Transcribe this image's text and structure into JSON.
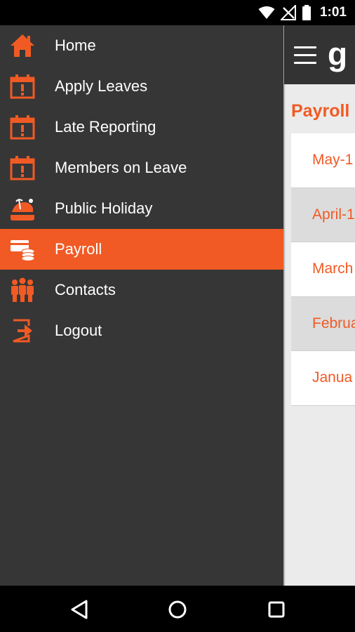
{
  "status_bar": {
    "time": "1:01",
    "icons": [
      "wifi-icon",
      "no-signal-icon",
      "battery-icon"
    ]
  },
  "app": {
    "logo_text": "g",
    "heading": "Payroll",
    "rows": [
      {
        "label": "May-1"
      },
      {
        "label": "April-1"
      },
      {
        "label": "March"
      },
      {
        "label": "Februa"
      },
      {
        "label": "Janua"
      }
    ]
  },
  "drawer": {
    "accent_color": "#f15a24",
    "background_color": "#363636",
    "items": [
      {
        "label": "Home",
        "icon": "home-icon",
        "active": false
      },
      {
        "label": "Apply Leaves",
        "icon": "calendar-alert-icon",
        "active": false
      },
      {
        "label": "Late Reporting",
        "icon": "calendar-alert-icon",
        "active": false
      },
      {
        "label": "Members on Leave",
        "icon": "calendar-alert-icon",
        "active": false
      },
      {
        "label": "Public Holiday",
        "icon": "beach-holiday-icon",
        "active": false
      },
      {
        "label": "Payroll",
        "icon": "payroll-money-icon",
        "active": true
      },
      {
        "label": "Contacts",
        "icon": "contacts-people-icon",
        "active": false
      },
      {
        "label": "Logout",
        "icon": "logout-icon",
        "active": false
      }
    ]
  },
  "nav_bar": {
    "buttons": [
      "back-icon",
      "home-circle-icon",
      "recents-square-icon"
    ]
  }
}
